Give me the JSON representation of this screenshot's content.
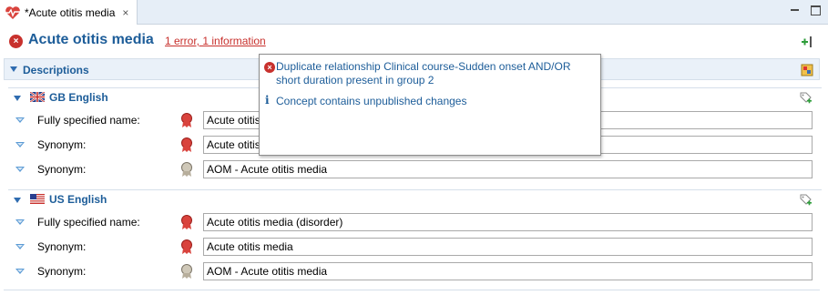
{
  "tab": {
    "label": "*Acute otitis media",
    "close_glyph": "×",
    "icon": "heart-pulse-icon"
  },
  "window": {
    "minimize_icon": "minimize-icon",
    "maximize_icon": "maximize-icon"
  },
  "header": {
    "title": "Acute otitis media",
    "problems_link": "1 error, 1 information",
    "error_glyph": "×"
  },
  "descriptions": {
    "label": "Descriptions",
    "groups": [
      {
        "label": "GB English",
        "flag": "uk-flag-icon",
        "rows": [
          {
            "type": "Fully specified name:",
            "value": "Acute otitis media (disorder)",
            "status": "unpublished"
          },
          {
            "type": "Synonym:",
            "value": "Acute otitis media",
            "status": "unpublished"
          },
          {
            "type": "Synonym:",
            "value": "AOM - Acute otitis media",
            "status": "published"
          }
        ]
      },
      {
        "label": "US English",
        "flag": "us-flag-icon",
        "rows": [
          {
            "type": "Fully specified name:",
            "value": "Acute otitis media (disorder)",
            "status": "unpublished"
          },
          {
            "type": "Synonym:",
            "value": "Acute otitis media",
            "status": "unpublished"
          },
          {
            "type": "Synonym:",
            "value": "AOM - Acute otitis media",
            "status": "published"
          }
        ]
      }
    ]
  },
  "popup": {
    "error_message": "Duplicate relationship Clinical course-Sudden onset AND/OR short duration present in group 2",
    "info_glyph": "i",
    "info_message": "Concept contains unpublished changes"
  },
  "colors": {
    "accent": "#1d5d99",
    "error": "#c8312d",
    "section_bg": "#eaf1f9"
  }
}
